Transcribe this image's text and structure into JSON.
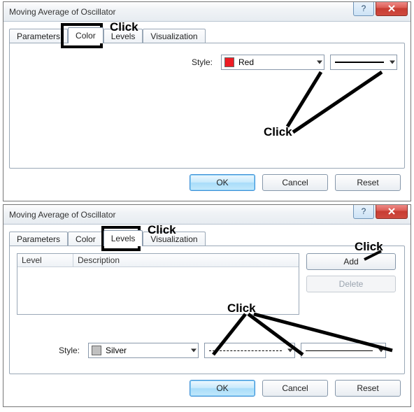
{
  "dialog1": {
    "title": "Moving Average of Oscillator",
    "tabs": {
      "t0": "Parameters",
      "t1": "Color",
      "t2": "Levels",
      "t3": "Visualization"
    },
    "style_label": "Style:",
    "color_name": "Red",
    "ok": "OK",
    "cancel": "Cancel",
    "reset": "Reset"
  },
  "dialog2": {
    "title": "Moving Average of Oscillator",
    "tabs": {
      "t0": "Parameters",
      "t1": "Color",
      "t2": "Levels",
      "t3": "Visualization"
    },
    "lv": {
      "col0": "Level",
      "col1": "Description"
    },
    "add": "Add",
    "delete": "Delete",
    "style_label": "Style:",
    "color_name": "Silver",
    "ok": "OK",
    "cancel": "Cancel",
    "reset": "Reset"
  },
  "anno": {
    "click": "Click"
  }
}
